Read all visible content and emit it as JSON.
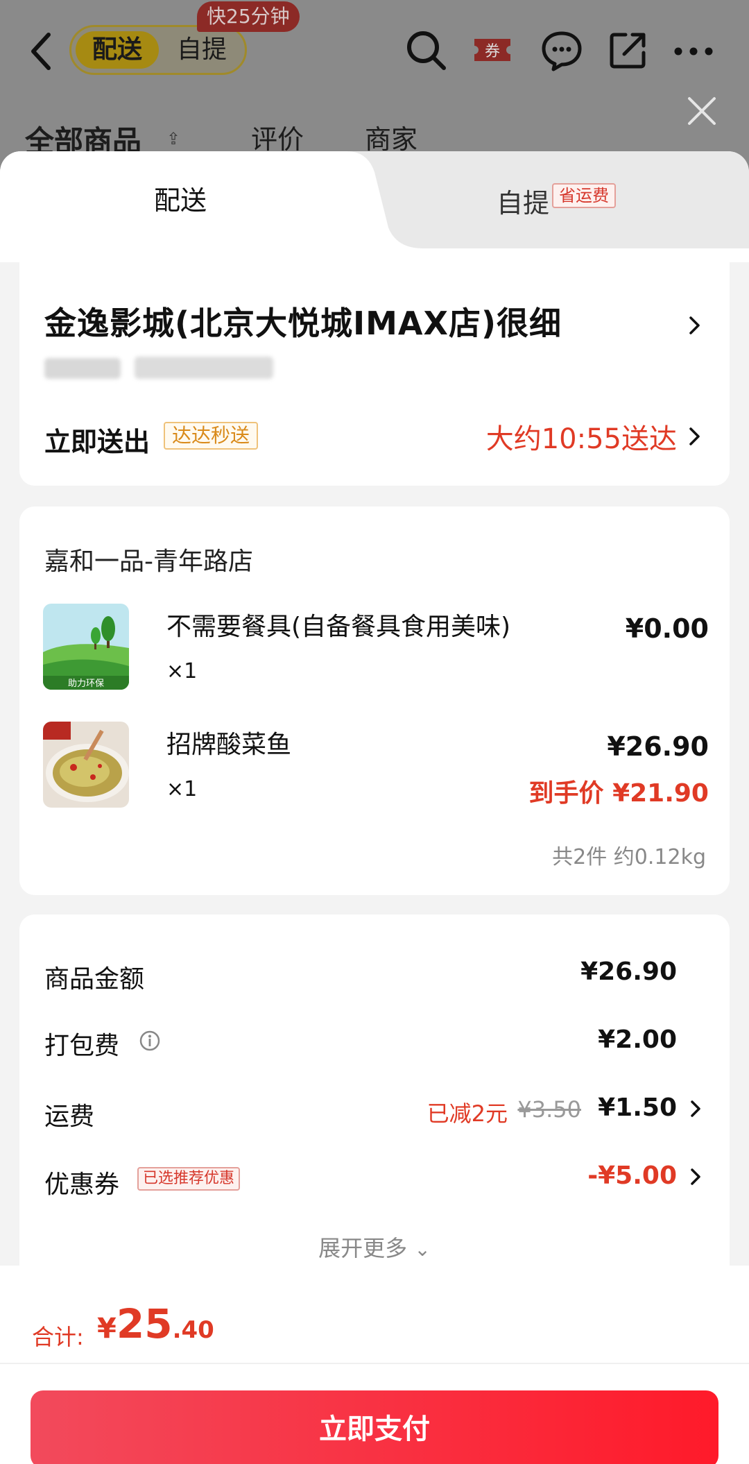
{
  "background_page": {
    "mode_switch": {
      "active": "配送",
      "other": "自提",
      "fast_badge": "快25分钟"
    },
    "coupon_icon_label": "券",
    "tabs": [
      "全部商品",
      "评价",
      "商家"
    ],
    "icons": [
      "back-icon",
      "search-icon",
      "coupon-icon",
      "chat-icon",
      "share-icon",
      "more-icon",
      "close-icon"
    ]
  },
  "sheet": {
    "tabs": {
      "delivery": "配送",
      "pickup": "自提",
      "pickup_badge": "省运费"
    },
    "address": {
      "title": "金逸影城(北京大悦城IMAX店)很细",
      "ship_label": "立即送出",
      "ship_badge": "达达秒送",
      "eta": "大约10:55送达"
    },
    "order": {
      "store": "嘉和一品-青年路店",
      "items": [
        {
          "name": "不需要餐具(自备餐具食用美味)",
          "qty": "×1",
          "price": "¥0.00",
          "final": "",
          "thumb_label": "助力环保"
        },
        {
          "name": "招牌酸菜鱼",
          "qty": "×1",
          "price": "¥26.90",
          "final": "到手价 ¥21.90",
          "thumb_label": ""
        }
      ],
      "summary": "共2件  约0.12kg"
    },
    "price": {
      "goods_label": "商品金额",
      "goods_value": "¥26.90",
      "packing_label": "打包费",
      "packing_value": "¥2.00",
      "shipping_label": "运费",
      "shipping_discount": "已减2元",
      "shipping_old": "¥3.50",
      "shipping_value": "¥1.50",
      "coupon_label": "优惠券",
      "coupon_badge": "已选推荐优惠",
      "coupon_value": "-¥5.00",
      "expand": "展开更多"
    },
    "total": {
      "label": "合计:",
      "yen": "¥",
      "int": "25",
      "dec": ".40"
    },
    "pay_button": "立即支付"
  },
  "colors": {
    "accent": "#e03a25",
    "pay_start": "#f24a5c",
    "pay_end": "#ff1a2a",
    "badge_orange": "#d98a1a"
  }
}
